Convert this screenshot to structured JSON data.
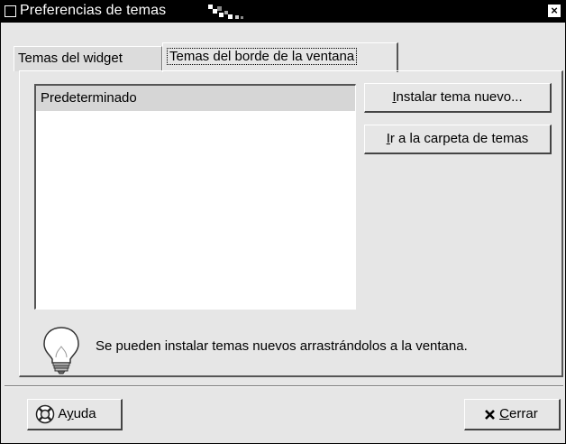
{
  "window": {
    "title": "Preferencias de temas",
    "close_glyph": "×"
  },
  "tabs": [
    {
      "label": "Temas del widget",
      "active": false
    },
    {
      "label": "Temas del borde de la ventana",
      "active": true
    }
  ],
  "theme_list": {
    "items": [
      {
        "label": "Predeterminado",
        "selected": true
      }
    ]
  },
  "buttons": {
    "install": {
      "mnemonic": "I",
      "rest": "nstalar tema nuevo..."
    },
    "folder": {
      "mnemonic": "I",
      "rest": "r a la carpeta de temas"
    },
    "help": {
      "pre": "A",
      "mnemonic": "y",
      "rest": "uda",
      "icon": "help-lifebuoy-icon"
    },
    "close": {
      "mnemonic": "C",
      "rest": "errar",
      "icon": "close-x-icon"
    }
  },
  "hint": {
    "icon": "lightbulb-icon",
    "text": "Se pueden instalar temas nuevos arrastrándolos a la ventana."
  },
  "colors": {
    "titlebar": "#000000",
    "window_bg": "#e6e6e6",
    "selection": "#d6d6d6"
  }
}
